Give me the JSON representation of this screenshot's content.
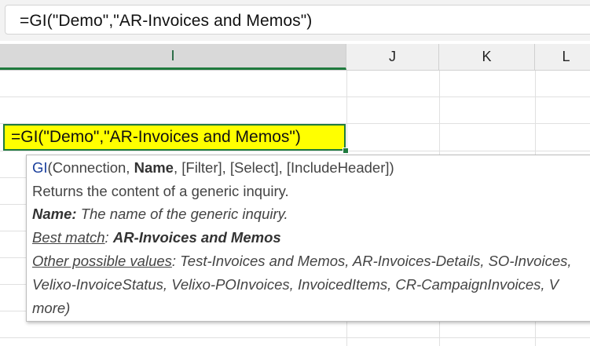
{
  "formula_bar": {
    "formula": "=GI(\"Demo\",\"AR-Invoices and Memos\")"
  },
  "columns": [
    {
      "label": "I",
      "active": true
    },
    {
      "label": "J",
      "active": false
    },
    {
      "label": "K",
      "active": false
    },
    {
      "label": "L",
      "active": false
    }
  ],
  "active_cell": {
    "text": "=GI(\"Demo\",\"AR-Invoices and Memos\")"
  },
  "tooltip": {
    "signature": {
      "fn_name": "GI",
      "open": "(Connection, ",
      "current_param": "Name",
      "rest": ", [Filter], [Select], [IncludeHeader])"
    },
    "description": "Returns the content of a generic inquiry.",
    "param_help": {
      "label": "Name:",
      "text": " The name of the generic inquiry."
    },
    "best_match": {
      "label": "Best match",
      "sep": ": ",
      "value": "AR-Invoices and Memos"
    },
    "other_values": {
      "label": "Other possible values",
      "line1": ": Test-Invoices and Memos, AR-Invoices-Details, SO-Invoices,",
      "line2": "Velixo-InvoiceStatus, Velixo-POInvoices, InvoicedItems, CR-CampaignInvoices, V",
      "line3": "more)"
    }
  }
}
